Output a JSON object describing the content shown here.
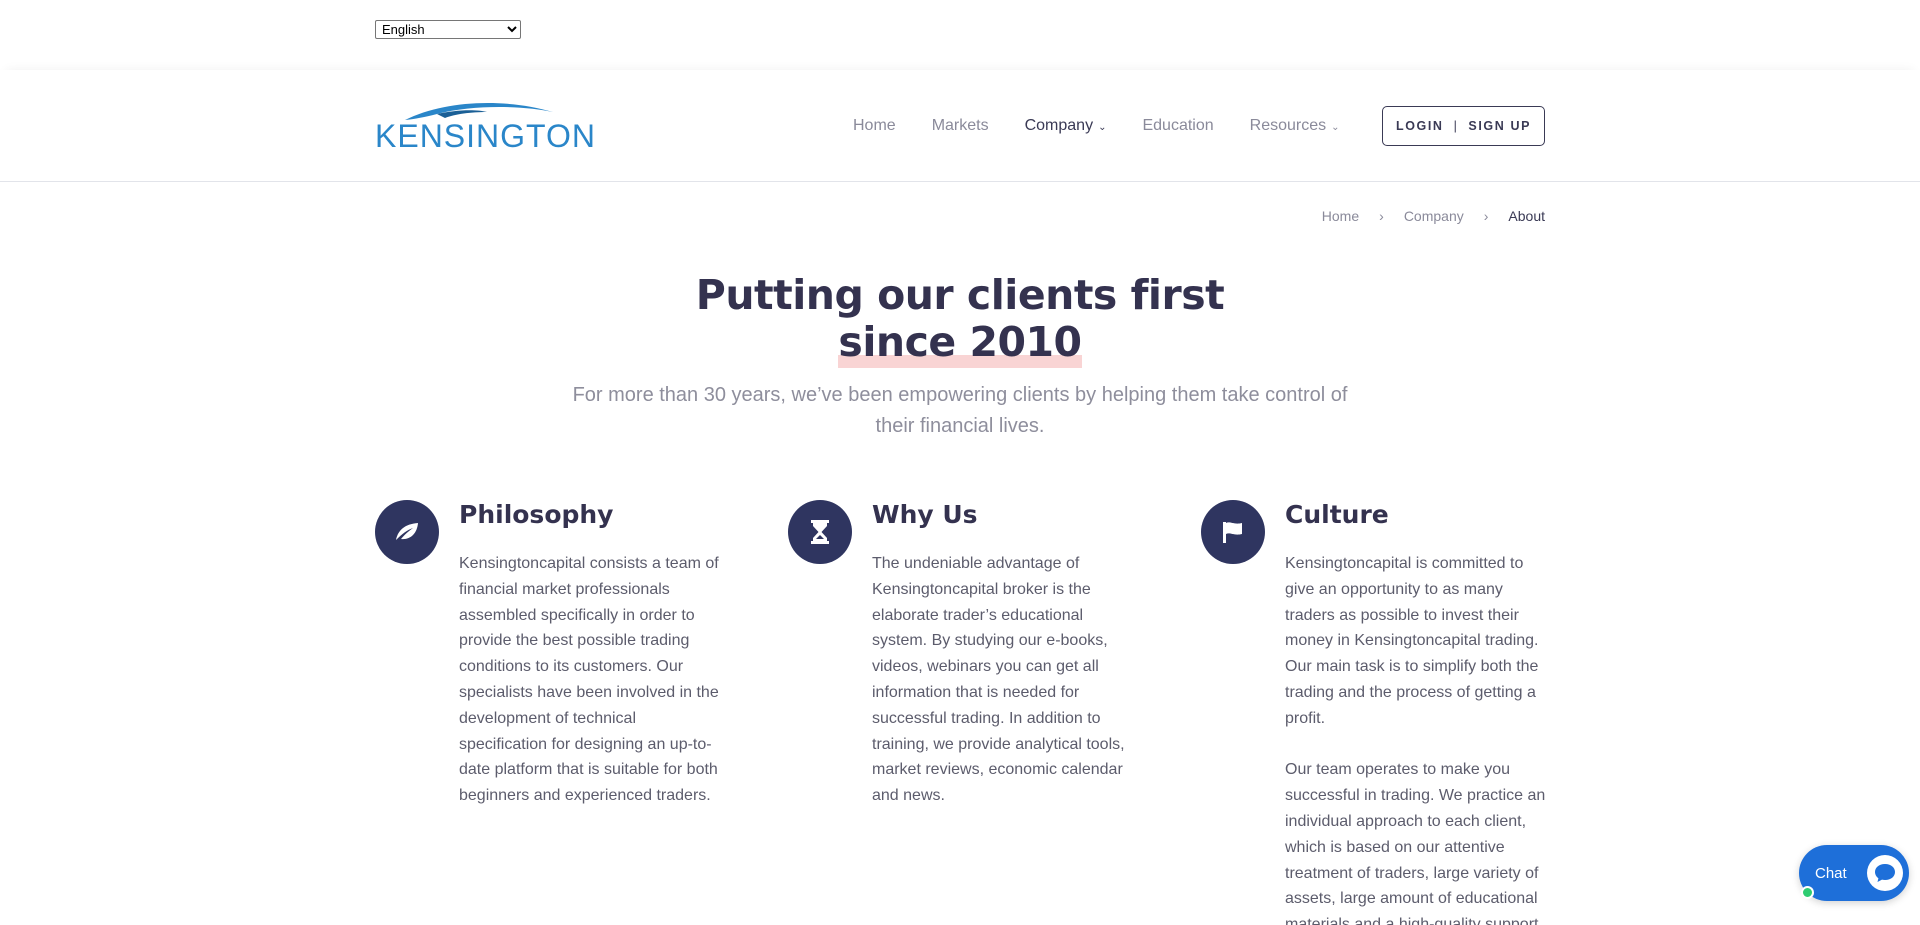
{
  "language_select": {
    "selected": "English"
  },
  "brand": {
    "logo_text": "KENSINGTON"
  },
  "nav": {
    "items": [
      {
        "label": "Home",
        "has_dropdown": false,
        "active": false
      },
      {
        "label": "Markets",
        "has_dropdown": false,
        "active": false
      },
      {
        "label": "Company",
        "has_dropdown": true,
        "active": true
      },
      {
        "label": "Education",
        "has_dropdown": false,
        "active": false
      },
      {
        "label": "Resources",
        "has_dropdown": true,
        "active": false
      }
    ],
    "login_label": "LOGIN",
    "separator": "|",
    "signup_label": "SIGN UP"
  },
  "breadcrumb": {
    "items": [
      "Home",
      "Company",
      "About"
    ]
  },
  "hero": {
    "title_line1": "Putting our clients first",
    "title_line2": "since 2010",
    "subtitle": "For more than 30 years, we’ve been empowering clients by helping them take control of their financial lives."
  },
  "features": [
    {
      "icon": "leaf-icon",
      "title": "Philosophy",
      "paragraphs": [
        "Kensingtoncapital consists a team of financial market professionals assembled specifically in order to provide the best possible trading conditions to its customers. Our specialists have been involved in the development of technical specification for designing an up-to-date platform that is suitable for both beginners and experienced traders."
      ]
    },
    {
      "icon": "hourglass-icon",
      "title": "Why Us",
      "paragraphs": [
        "The undeniable advantage of Kensingtoncapital broker is the elaborate trader’s educational system. By studying our e-books, videos, webinars you can get all information that is needed for successful trading. In addition to training, we provide analytical tools, market reviews, economic calendar and news."
      ]
    },
    {
      "icon": "flag-icon",
      "title": "Culture",
      "paragraphs": [
        "Kensingtoncapital is committed to give an opportunity to as many traders as possible to invest their money in Kensingtoncapital trading. Our main task is to simplify both the trading and the process of getting a profit.",
        "Our team operates to make you successful in trading. We practice an individual approach to each client, which is based on our attentive treatment of traders, large variety of assets, large amount of educational materials and a high-quality support"
      ]
    }
  ],
  "chat": {
    "label": "Chat",
    "status": "online"
  },
  "colors": {
    "brand_blue": "#2a86c9",
    "navy": "#2f3560",
    "heading": "#34324f",
    "highlight": "#f9d4d4",
    "chat_blue": "#1e6fd9",
    "online_green": "#2ecc71"
  }
}
